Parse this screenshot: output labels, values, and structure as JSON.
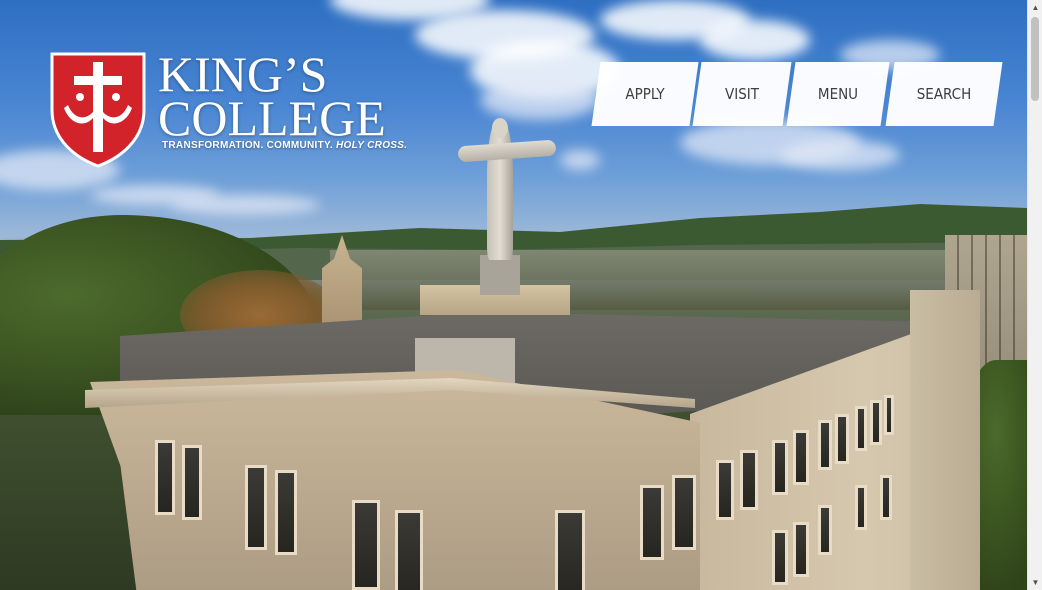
{
  "brand": {
    "name_line1": "KING’S",
    "name_line2": "COLLEGE",
    "tagline_main": "TRANSFORMATION. COMMUNITY. ",
    "tagline_emphasis": "HOLY CROSS.",
    "shield_color": "#d2232a",
    "icon": "kings-college-crest-icon"
  },
  "nav": {
    "apply": "APPLY",
    "visit": "VISIT",
    "menu": "MENU",
    "search": "SEARCH"
  },
  "hero": {
    "image": "aerial view of campus building with statue"
  },
  "scrollbar": {
    "up_icon": "scroll-up-arrow-icon",
    "down_icon": "scroll-down-arrow-icon",
    "up_glyph": "▲",
    "down_glyph": "▼"
  }
}
